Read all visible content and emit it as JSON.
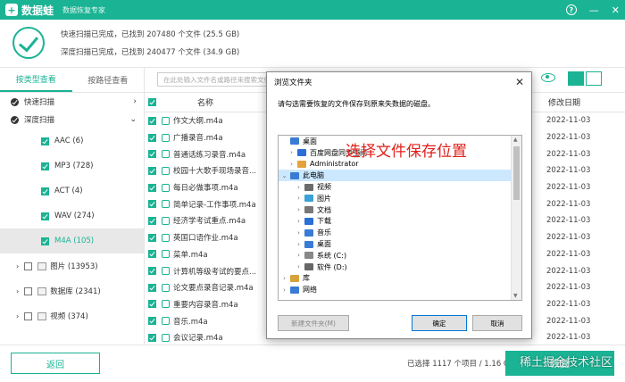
{
  "app": {
    "name": "数据蛙",
    "subtitle": "数据恢复专家"
  },
  "window_controls": {
    "help": "?",
    "minimize": "—",
    "close": "✕"
  },
  "scan": {
    "quick": "快速扫描已完成，已找到 207480 个文件 (25.5 GB)",
    "deep": "深度扫描已完成，已找到 240477 个文件 (34.9 GB)"
  },
  "left": {
    "tabs": [
      "按类型查看",
      "按路径查看"
    ],
    "quick_scan": "快速扫描",
    "deep_scan": "深度扫描",
    "audio_types": [
      {
        "label": "AAC (6)"
      },
      {
        "label": "MP3 (728)"
      },
      {
        "label": "ACT (4)"
      },
      {
        "label": "WAV (274)"
      },
      {
        "label": "M4A (105)"
      }
    ],
    "categories": [
      {
        "label": "图片 (13953)"
      },
      {
        "label": "数据库 (2341)"
      },
      {
        "label": "视频 (374)"
      }
    ]
  },
  "toolbar": {
    "search_placeholder": "在此处输入文件名或路径来搜索文件"
  },
  "list": {
    "col_name": "名称",
    "col_date": "修改日期",
    "rows": [
      {
        "name": "作文大纲.m4a",
        "date": "2022-11-03"
      },
      {
        "name": "广播录音.m4a",
        "date": "2022-11-03"
      },
      {
        "name": "普通话练习录音.m4a",
        "date": "2022-11-03"
      },
      {
        "name": "校园十大歌手现场录音...",
        "date": "2022-11-03"
      },
      {
        "name": "每日必做事项.m4a",
        "date": "2022-11-03"
      },
      {
        "name": "简单记录-工作事项.m4a",
        "date": "2022-11-03"
      },
      {
        "name": "经济学考试重点.m4a",
        "date": "2022-11-03"
      },
      {
        "name": "英国口语作业.m4a",
        "date": "2022-11-03"
      },
      {
        "name": "菜单.m4a",
        "date": "2022-11-03"
      },
      {
        "name": "计算机等级考试的要点...",
        "date": "2022-11-03"
      },
      {
        "name": "论文要点录音记录.m4a",
        "date": "2022-11-03"
      },
      {
        "name": "重要内容录音.m4a",
        "date": "2022-11-03"
      },
      {
        "name": "音乐.m4a",
        "date": "2022-11-03"
      },
      {
        "name": "会议记录.m4a",
        "date": "2022-11-03"
      }
    ]
  },
  "bottom": {
    "back": "返回",
    "status": "已选择 1117 个项目 / 1.16 GB",
    "recover": "恢复",
    "watermark": "稀土掘金技术社区"
  },
  "dialog": {
    "title": "浏览文件夹",
    "close": "✕",
    "message": "请勾选需要恢复的文件保存到原来失数据的磁盘。",
    "overlay": "选择文件保存位置",
    "tree": [
      {
        "label": "桌面"
      },
      {
        "label": "百度网盘同步空间"
      },
      {
        "label": "Administrator"
      },
      {
        "label": "此电脑"
      },
      {
        "label": "视频"
      },
      {
        "label": "图片"
      },
      {
        "label": "文档"
      },
      {
        "label": "下载"
      },
      {
        "label": "音乐"
      },
      {
        "label": "桌面"
      },
      {
        "label": "系统 (C:)"
      },
      {
        "label": "软件 (D:)"
      },
      {
        "label": "库"
      },
      {
        "label": "网络"
      }
    ],
    "btn_new_folder": "新建文件夹(M)",
    "btn_ok": "确定",
    "btn_cancel": "取消"
  }
}
